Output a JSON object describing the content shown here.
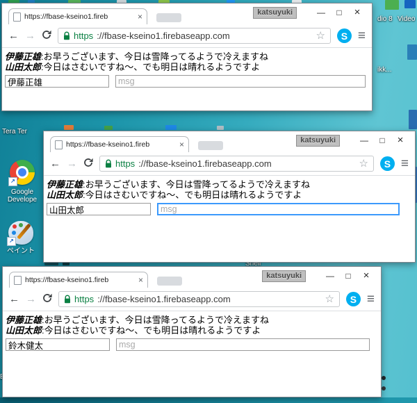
{
  "overlay_label": "katsuyuki",
  "browser": {
    "tab_title": "https://fbase-kseino1.fireb",
    "url_scheme": "https",
    "url_rest": "://fbase-kseino1.firebaseapp.com"
  },
  "chat": {
    "messages": [
      {
        "name": "伊藤正雄",
        "sep": ":",
        "text": "お早うございます、今日は雪降ってるようで冷えますね"
      },
      {
        "name": "山田太郎",
        "sep": ":",
        "text": "今日はさむいですね～、でも明日は晴れるようですよ"
      }
    ],
    "msg_placeholder": "msg"
  },
  "windows": [
    {
      "name_value": "伊藤正雄"
    },
    {
      "name_value": "山田太郎"
    },
    {
      "name_value": "鈴木健太"
    }
  ],
  "glyphs": {
    "back": "←",
    "forward": "→",
    "star": "☆",
    "menu": "≡",
    "minimize": "—",
    "maximize": "□",
    "close": "×",
    "tab_close": "×",
    "skype": "S",
    "shortcut_arrow": "↗"
  },
  "desktop": {
    "labels": {
      "tera_term": "Tera Ter",
      "google_line1": "Google",
      "google_line2": "Develope",
      "paint": "ペイント",
      "shell": "Shell",
      "studio": "dio 8",
      "video": "Video",
      "ikk": "ikk...",
      "e": "E"
    },
    "colors": {
      "teal_dark": "#0e7f96",
      "teal_light": "#63c7d5",
      "url_green": "#0b8043",
      "skype_blue": "#00aff0",
      "focus_blue": "#3b99fc"
    }
  }
}
